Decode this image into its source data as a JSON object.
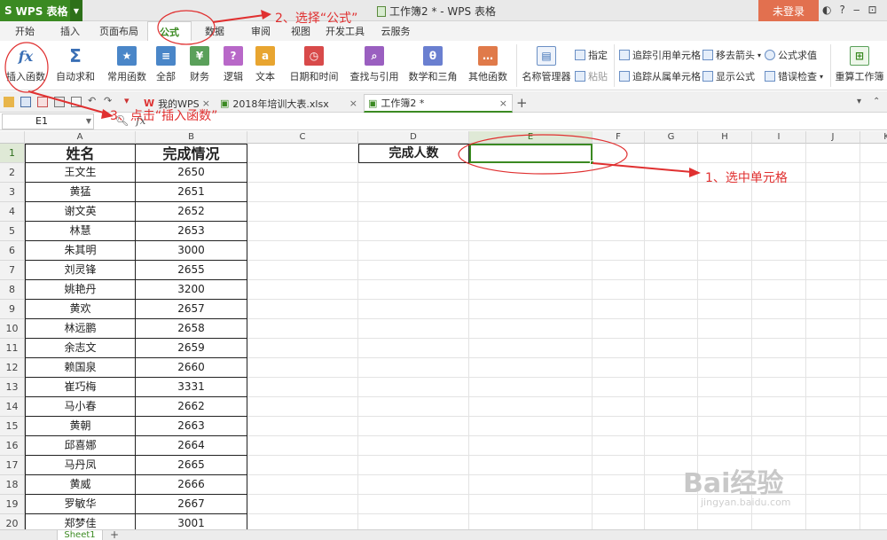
{
  "app": {
    "name": "WPS 表格",
    "logo": "S",
    "login": "未登录",
    "window_title": "工作簿2 * - WPS 表格"
  },
  "tabs": [
    "开始",
    "插入",
    "页面布局",
    "公式",
    "数据",
    "审阅",
    "视图",
    "开发工具",
    "云服务"
  ],
  "ribbon": {
    "insert_function": "插入函数",
    "autosum": "自动求和",
    "common": "常用函数",
    "all": "全部",
    "finance": "财务",
    "logic": "逻辑",
    "text": "文本",
    "datetime": "日期和时间",
    "lookup": "查找与引用",
    "math": "数学和三角",
    "other": "其他函数",
    "name_manager": "名称管理器",
    "define": "指定",
    "paste": "粘贴",
    "trace_precedents": "追踪引用单元格",
    "trace_dependents": "追踪从属单元格",
    "remove_arrows": "移去箭头",
    "show_formulas": "显示公式",
    "evaluate": "公式求值",
    "error_check": "错误检查",
    "recalc": "重算工作簿"
  },
  "doc_tabs": [
    "我的WPS",
    "2018年培训大表.xlsx",
    "工作簿2 *"
  ],
  "formula_bar": {
    "name_box": "E1",
    "fx": "fx"
  },
  "columns": [
    "A",
    "B",
    "C",
    "D",
    "E",
    "F",
    "G",
    "H",
    "I",
    "J",
    "K"
  ],
  "rows": [
    "1",
    "2",
    "3",
    "4",
    "5",
    "6",
    "7",
    "8",
    "9",
    "10",
    "11",
    "12",
    "13",
    "14",
    "15",
    "16",
    "17",
    "18",
    "19",
    "20"
  ],
  "table": {
    "header_name": "姓名",
    "header_status": "完成情况",
    "d1": "完成人数",
    "names": [
      "王文生",
      "黄猛",
      "谢文英",
      "林慧",
      "朱其明",
      "刘灵锋",
      "姚艳丹",
      "黄欢",
      "林远鹏",
      "余志文",
      "赖国泉",
      "崔巧梅",
      "马小春",
      "黄朝",
      "邱喜娜",
      "马丹凤",
      "黄威",
      "罗敏华",
      "郑梦佳"
    ],
    "values": [
      "2650",
      "2651",
      "2652",
      "2653",
      "3000",
      "2655",
      "3200",
      "2657",
      "2658",
      "2659",
      "2660",
      "3331",
      "2662",
      "2663",
      "2664",
      "2665",
      "2666",
      "2667",
      "3001"
    ]
  },
  "sheet_tab": "Sheet1",
  "annotations": {
    "step1": "1、选中单元格",
    "step2": "2、选择“公式”",
    "step3": "3、点击“插入函数”",
    "color": "#e03030"
  },
  "watermark": {
    "main": "Bai经验",
    "sub": "jingyan.baidu.com"
  },
  "colors": {
    "accent": "#3b8a22",
    "login": "#e2704f"
  }
}
